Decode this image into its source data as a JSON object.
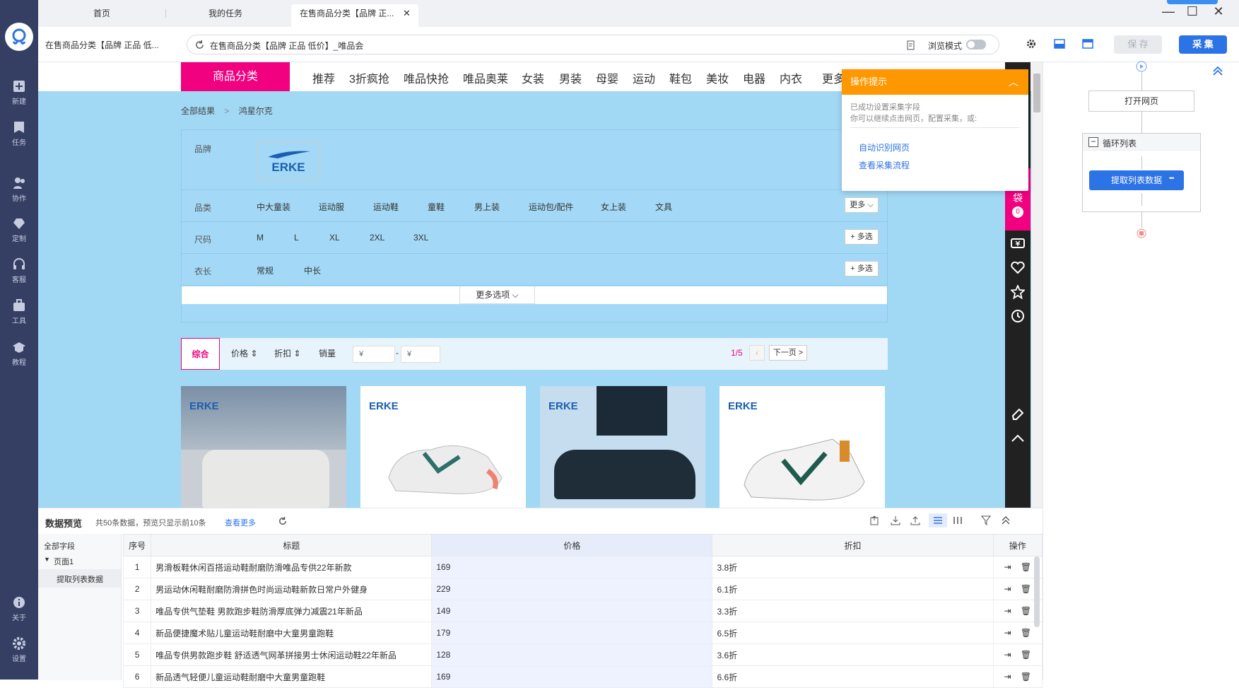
{
  "tabs": [
    "首页",
    "我的任务",
    "在售商品分类【品牌 正..."
  ],
  "window": {
    "minimize": "—",
    "maximize": "☐",
    "close": "✕"
  },
  "address": {
    "page_name": "在售商品分类【品牌 正品 低...",
    "url": "在售商品分类【品牌 正品 低价】_唯品会",
    "browse_mode_label": "浏览模式",
    "save_label": "保 存",
    "collect_label": "采 集"
  },
  "sidebar": {
    "items": [
      {
        "label": "新建",
        "icon": "plus-icon"
      },
      {
        "label": "任务",
        "icon": "task-icon"
      },
      {
        "label": "协作",
        "icon": "collab-icon"
      },
      {
        "label": "定制",
        "icon": "custom-icon"
      },
      {
        "label": "客服",
        "icon": "headset-icon"
      },
      {
        "label": "工具",
        "icon": "toolbox-icon"
      },
      {
        "label": "教程",
        "icon": "tutorial-icon"
      },
      {
        "label": "关于",
        "icon": "info-icon"
      },
      {
        "label": "设置",
        "icon": "gear-icon"
      }
    ]
  },
  "site": {
    "category_label": "商品分类",
    "nav": [
      "推荐",
      "3折疯抢",
      "唯品快抢",
      "唯品奥莱",
      "女装",
      "男装",
      "母婴",
      "运动",
      "鞋包",
      "美妆",
      "电器",
      "内衣",
      "更多"
    ],
    "breadcrumb": {
      "root": "全部结果",
      "sep": ">",
      "current": "鸿星尔克"
    },
    "filters": {
      "brand_label": "品牌",
      "brand_logo": "ERKE",
      "category_label": "品类",
      "categories": [
        "中大童装",
        "运动服",
        "运动鞋",
        "童鞋",
        "男上装",
        "运动包/配件",
        "女上装",
        "文具"
      ],
      "category_more": "更多 ⌵",
      "size_label": "尺码",
      "sizes": [
        "M",
        "L",
        "XL",
        "2XL",
        "3XL"
      ],
      "size_multi": "+ 多选",
      "length_label": "衣长",
      "lengths": [
        "常规",
        "中长"
      ],
      "length_multi": "+ 多选",
      "more_options": "更多选项 ⌵"
    },
    "sort": {
      "comprehensive": "综合",
      "price": "价格 ⇕",
      "discount": "折扣 ⇕",
      "sales": "销量",
      "price_from": "¥",
      "price_sep": "-",
      "price_to": "¥",
      "page": "1/5",
      "next": "下一页 >"
    },
    "cards": [
      "ERKE",
      "ERKE",
      "ERKE",
      "ERKE"
    ],
    "cart": {
      "label": "购物袋",
      "count": "0"
    }
  },
  "tip": {
    "title": "操作提示",
    "line1": "已成功设置采集字段",
    "line2": "你可以继续点击网页，配置采集，或:",
    "link1": "自动识别网页",
    "link2": "查看采集流程"
  },
  "flow": {
    "open_page": "打开网页",
    "loop_list": "循环列表",
    "extract": "提取列表数据",
    "extract_more": "•••"
  },
  "preview": {
    "title": "数据预览",
    "summary": "共50条数据，预览只显示前10条",
    "view_more": "查看更多",
    "tree": {
      "all_fields": "全部字段",
      "page1": "页面1",
      "extract": "提取列表数据"
    },
    "columns": [
      "序号",
      "标题",
      "价格",
      "折扣",
      "操作"
    ],
    "rows": [
      {
        "seq": "1",
        "title": "男滑板鞋休闲百搭运动鞋耐磨防滑唯品专供22年新款",
        "price": "169",
        "discount": "3.8折"
      },
      {
        "seq": "2",
        "title": "男运动休闲鞋耐磨防滑拼色时尚运动鞋新款日常户外健身",
        "price": "229",
        "discount": "6.1折"
      },
      {
        "seq": "3",
        "title": "唯品专供气垫鞋 男款跑步鞋防滑厚底弹力减震21年新品",
        "price": "149",
        "discount": "3.3折"
      },
      {
        "seq": "4",
        "title": "新品便捷魔术贴儿童运动鞋耐磨中大童男童跑鞋",
        "price": "179",
        "discount": "6.5折"
      },
      {
        "seq": "5",
        "title": "唯品专供男款跑步鞋 舒适透气网革拼接男士休闲运动鞋22年新品",
        "price": "128",
        "discount": "3.6折"
      },
      {
        "seq": "6",
        "title": "新品透气轻便儿童运动鞋耐磨中大童男童跑鞋",
        "price": "169",
        "discount": "6.6折"
      }
    ]
  },
  "colors": {
    "accent": "#2c73e6",
    "brand_pink": "#f10180",
    "tip_orange": "#ff9800",
    "page_bg": "#a1d8f4",
    "sidebar": "#343f63"
  }
}
